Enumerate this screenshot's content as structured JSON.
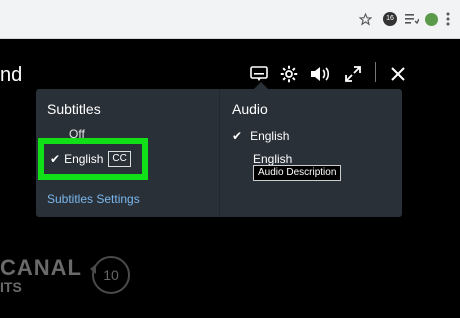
{
  "browser": {
    "toolbar_icons": [
      "star-icon",
      "extension-icon",
      "reading-list-icon",
      "profile-avatar",
      "menu-kebab-icon"
    ],
    "extension_badge": "16",
    "avatar_color": "#5a9a4a"
  },
  "player": {
    "title_partial": "nd",
    "controls": [
      "subtitles-icon",
      "gear-icon",
      "volume-icon",
      "fullscreen-icon",
      "close-icon"
    ],
    "channel_line1": "CANAL",
    "channel_line2": "ITS",
    "rewind_label": "10"
  },
  "menu": {
    "subtitles": {
      "heading": "Subtitles",
      "options": [
        {
          "label": "Off",
          "selected": false
        },
        {
          "label": "English",
          "badge": "CC",
          "selected": true
        }
      ],
      "settings_link": "Subtitles Settings"
    },
    "audio": {
      "heading": "Audio",
      "options": [
        {
          "label": "English",
          "selected": true
        },
        {
          "label": "English",
          "badge": "Audio Description",
          "selected": false
        }
      ]
    }
  },
  "colors": {
    "highlight": "#11e018",
    "menu_bg": "#2a3038",
    "link": "#7ab8ee"
  }
}
